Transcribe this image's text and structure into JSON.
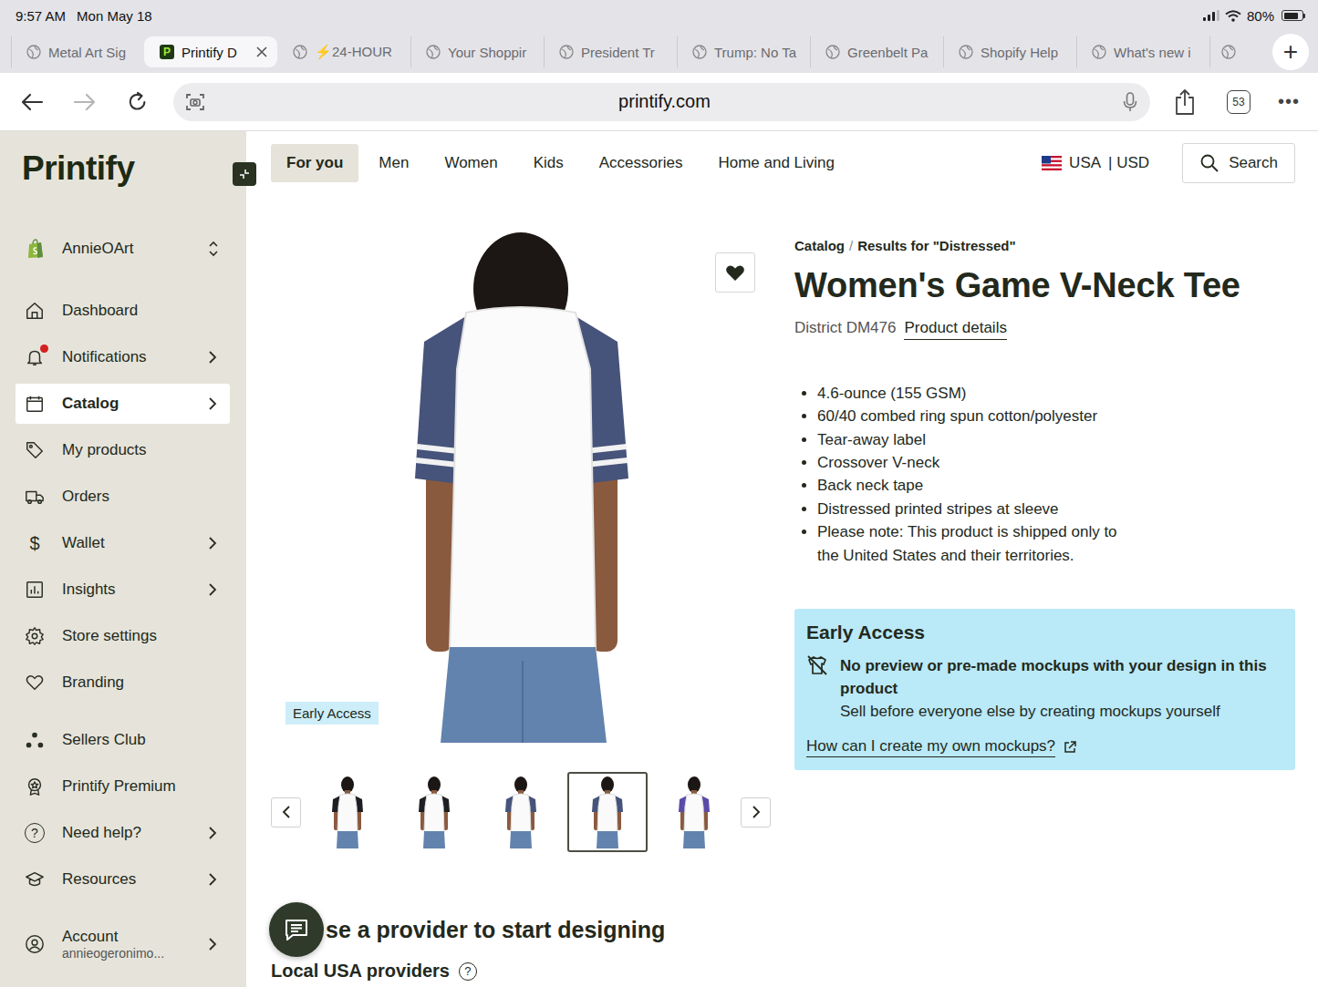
{
  "status_bar": {
    "time": "9:57 AM",
    "date": "Mon May 18",
    "battery": "80%",
    "battery_level": 0.8
  },
  "browser_tabs": [
    {
      "label": "Metal Art Sig",
      "selected": false,
      "favicon": ""
    },
    {
      "label": "Printify D",
      "selected": true,
      "favicon": "P"
    },
    {
      "label": "⚡24-HOUR",
      "selected": false,
      "favicon": ""
    },
    {
      "label": "Your Shoppir",
      "selected": false,
      "favicon": ""
    },
    {
      "label": "President Tr",
      "selected": false,
      "favicon": ""
    },
    {
      "label": "Trump: No Ta",
      "selected": false,
      "favicon": ""
    },
    {
      "label": "Greenbelt Pa",
      "selected": false,
      "favicon": ""
    },
    {
      "label": "Shopify Help",
      "selected": false,
      "favicon": ""
    },
    {
      "label": "What's new i",
      "selected": false,
      "favicon": ""
    }
  ],
  "more_tabs": true,
  "new_tab_button": "+",
  "address_bar": {
    "url": "printify.com",
    "back_enabled": true,
    "forward_enabled": false,
    "tab_count": "53",
    "menu": "•••"
  },
  "sidebar": {
    "logo": "Printify",
    "store": "AnnieOArt",
    "items": [
      {
        "label": "Dashboard",
        "selected": false,
        "chevron": false,
        "alert": false,
        "icon_text": ""
      },
      {
        "label": "Notifications",
        "selected": false,
        "chevron": true,
        "alert": true,
        "icon_text": ""
      },
      {
        "label": "Catalog",
        "selected": true,
        "chevron": true,
        "alert": false,
        "icon_text": ""
      },
      {
        "label": "My products",
        "selected": false,
        "chevron": false,
        "alert": false,
        "icon_text": ""
      },
      {
        "label": "Orders",
        "selected": false,
        "chevron": false,
        "alert": false,
        "icon_text": ""
      },
      {
        "label": "Wallet",
        "selected": false,
        "chevron": true,
        "alert": false,
        "icon_text": "$"
      },
      {
        "label": "Insights",
        "selected": false,
        "chevron": true,
        "alert": false,
        "icon_text": ""
      },
      {
        "label": "Store settings",
        "selected": false,
        "chevron": false,
        "alert": false,
        "icon_text": ""
      },
      {
        "label": "Branding",
        "selected": false,
        "chevron": false,
        "alert": false,
        "icon_text": ""
      }
    ],
    "items_secondary": [
      {
        "label": "Sellers Club",
        "selected": false,
        "chevron": false,
        "alert": false,
        "icon_text": ""
      },
      {
        "label": "Printify Premium",
        "selected": false,
        "chevron": false,
        "alert": false,
        "icon_text": ""
      },
      {
        "label": "Need help?",
        "selected": false,
        "chevron": true,
        "alert": false,
        "icon_text": "?"
      },
      {
        "label": "Resources",
        "selected": false,
        "chevron": true,
        "alert": false,
        "icon_text": ""
      }
    ],
    "account": {
      "label": "Account",
      "email": "annieogeronimo..."
    }
  },
  "top_nav": {
    "items": [
      {
        "label": "For you",
        "selected": true
      },
      {
        "label": "Men",
        "selected": false
      },
      {
        "label": "Women",
        "selected": false
      },
      {
        "label": "Kids",
        "selected": false
      },
      {
        "label": "Accessories",
        "selected": false
      },
      {
        "label": "Home and Living",
        "selected": false
      }
    ],
    "region": "USA",
    "currency": "| USD",
    "search": "Search"
  },
  "product": {
    "breadcrumb": [
      "Catalog",
      "Results for \"Distressed\""
    ],
    "separator": "/",
    "title": "Women's Game V-Neck Tee",
    "sku": "District DM476",
    "details_link": "Product details",
    "features": [
      "4.6-ounce (155 GSM)",
      "60/40 combed ring spun cotton/polyester",
      "Tear-away label",
      "Crossover V-neck",
      "Back neck tape",
      "Distressed printed stripes at sleeve",
      "Please note: This product is shipped only to the United States and their territories."
    ],
    "favorite": true,
    "badge": "Early Access",
    "thumbnails": [
      {
        "selected": false,
        "color": "#1e1e22"
      },
      {
        "selected": false,
        "color": "#1e1e22"
      },
      {
        "selected": false,
        "color": "#46537a"
      },
      {
        "selected": true,
        "color": "#46537a"
      },
      {
        "selected": false,
        "color": "#5b4aa8"
      }
    ],
    "early_access": {
      "title": "Early Access",
      "heading": "No preview or pre-made mockups with your design in this product",
      "body": "Sell before everyone else by creating mockups yourself",
      "link": "How can I create my own mockups?"
    }
  },
  "providers": {
    "heading": "se a provider to start designing",
    "subheading": "Local USA providers",
    "help": "?"
  }
}
